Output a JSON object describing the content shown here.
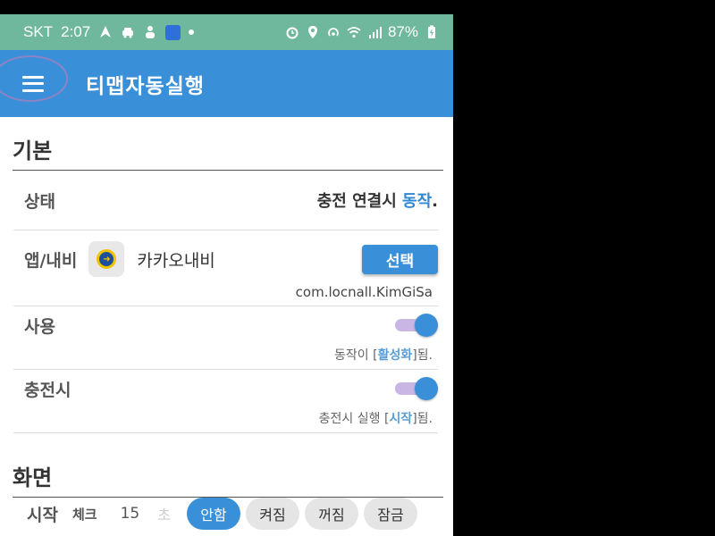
{
  "status_bar": {
    "carrier": "SKT",
    "time": "2:07",
    "battery": "87%"
  },
  "app_bar": {
    "title": "티맵자동실행"
  },
  "sections": {
    "basic": "기본",
    "screen": "화면"
  },
  "status_row": {
    "label": "상태",
    "value_prefix": "충전 연결시 ",
    "value_accent": "동작",
    "value_suffix": "."
  },
  "app_row": {
    "label": "앱/내비",
    "app_name": "카카오내비",
    "select_label": "선택",
    "package": "com.locnall.KimGiSa"
  },
  "use_row": {
    "label": "사용",
    "enabled": true,
    "desc_prefix": "동작이 [",
    "desc_highlight": "활성화",
    "desc_suffix": "]됨."
  },
  "charging_row": {
    "label": "충전시",
    "enabled": true,
    "desc_prefix": "충전시 실행 [",
    "desc_highlight": "시작",
    "desc_suffix": "]됨."
  },
  "start_row": {
    "label": "시작",
    "check_label": "체크",
    "seconds": "15",
    "seconds_unit": "초",
    "options": [
      "안함",
      "켜짐",
      "꺼짐",
      "잠금"
    ],
    "selected": "안함"
  },
  "colors": {
    "status_bar": "#6fb89e",
    "app_bar": "#3a90d8",
    "accent": "#2f88d4"
  }
}
